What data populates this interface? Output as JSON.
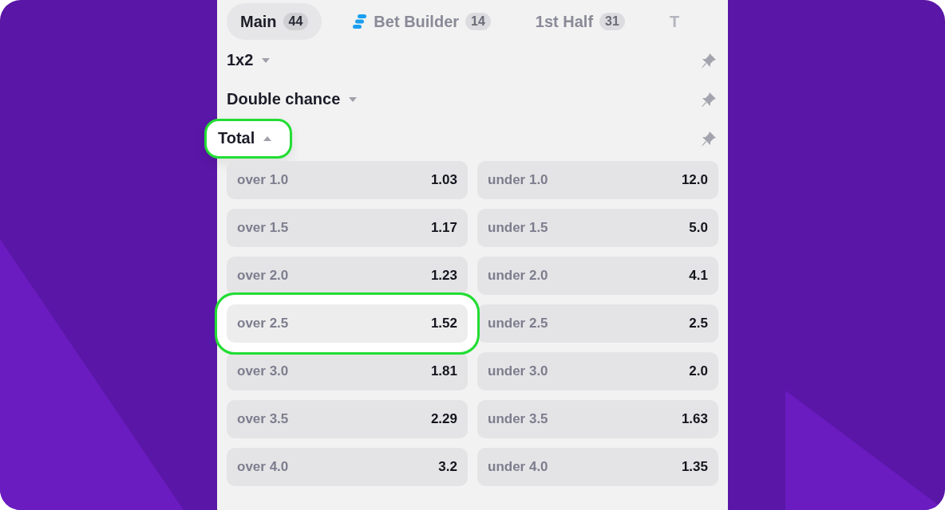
{
  "tabs": [
    {
      "label": "Main",
      "count": "44",
      "selected": true,
      "has_icon": false
    },
    {
      "label": "Bet Builder",
      "count": "14",
      "selected": false,
      "has_icon": true
    },
    {
      "label": "1st Half",
      "count": "31",
      "selected": false,
      "has_icon": false
    },
    {
      "label": "T",
      "selected": false,
      "has_icon": false
    }
  ],
  "markets": [
    {
      "title": "1x2",
      "expanded": false,
      "highlighted": false
    },
    {
      "title": "Double chance",
      "expanded": false,
      "highlighted": false
    },
    {
      "title": "Total",
      "expanded": true,
      "highlighted": true,
      "outcomes": [
        {
          "label": "over 1.0",
          "odds": "1.03",
          "highlighted": false
        },
        {
          "label": "under 1.0",
          "odds": "12.0",
          "highlighted": false
        },
        {
          "label": "over 1.5",
          "odds": "1.17",
          "highlighted": false
        },
        {
          "label": "under 1.5",
          "odds": "5.0",
          "highlighted": false
        },
        {
          "label": "over 2.0",
          "odds": "1.23",
          "highlighted": false
        },
        {
          "label": "under 2.0",
          "odds": "4.1",
          "highlighted": false
        },
        {
          "label": "over 2.5",
          "odds": "1.52",
          "highlighted": true
        },
        {
          "label": "under 2.5",
          "odds": "2.5",
          "highlighted": false
        },
        {
          "label": "over 3.0",
          "odds": "1.81",
          "highlighted": false
        },
        {
          "label": "under 3.0",
          "odds": "2.0",
          "highlighted": false
        },
        {
          "label": "over 3.5",
          "odds": "2.29",
          "highlighted": false
        },
        {
          "label": "under 3.5",
          "odds": "1.63",
          "highlighted": false
        },
        {
          "label": "over 4.0",
          "odds": "3.2",
          "highlighted": false
        },
        {
          "label": "under 4.0",
          "odds": "1.35",
          "highlighted": false
        }
      ]
    }
  ]
}
